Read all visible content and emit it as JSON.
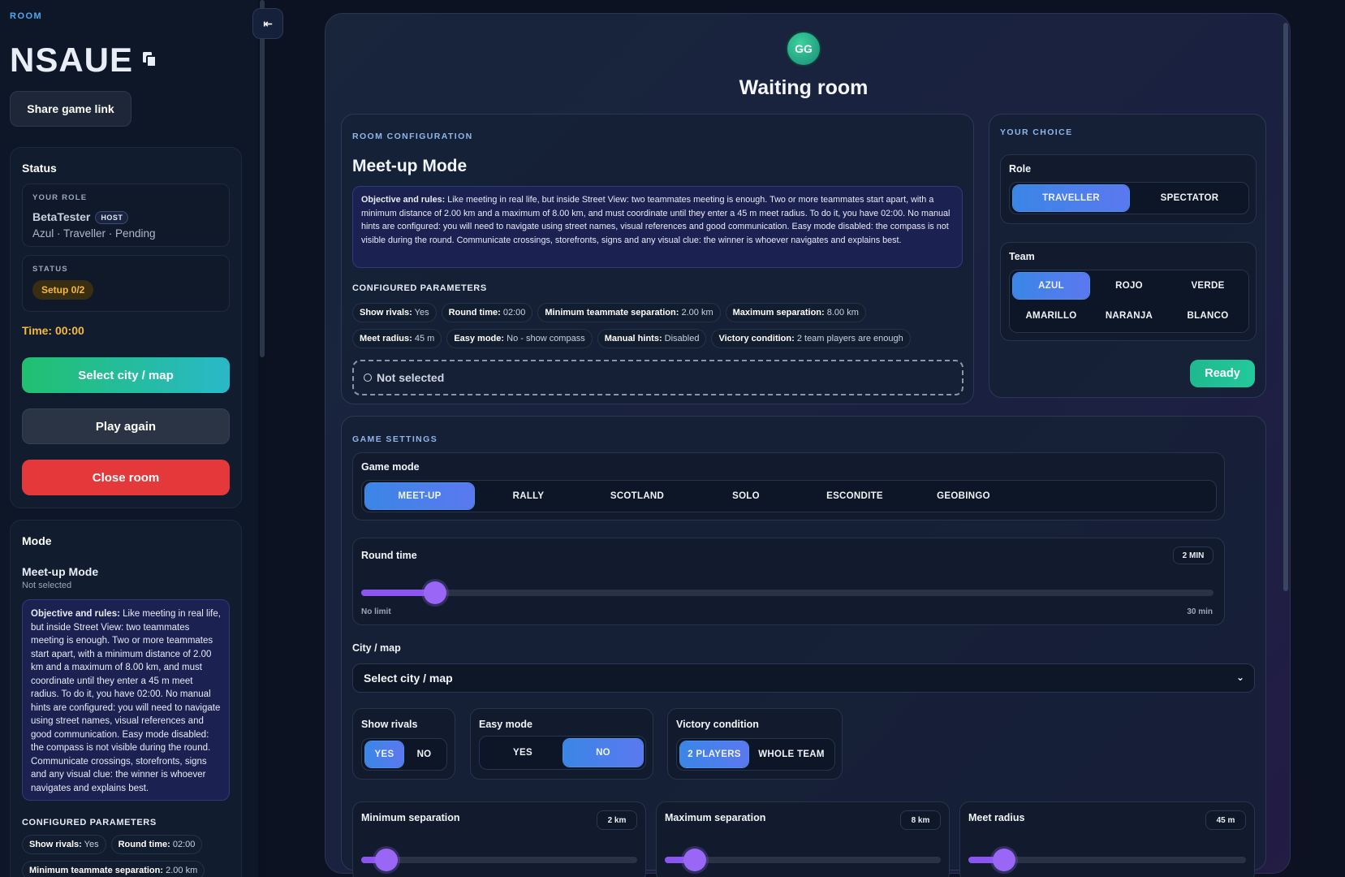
{
  "sidebar": {
    "room_label": "ROOM",
    "room_code": "NSAUE",
    "share_label": "Share game link",
    "status": {
      "heading": "Status",
      "your_role_label": "YOUR ROLE",
      "player_name": "BetaTester",
      "host_badge": "HOST",
      "role_detail": "Azul · Traveller · Pending",
      "status_label": "STATUS",
      "setup_badge": "Setup 0/2",
      "time": "Time: 00:00",
      "select_city_btn": "Select city / map",
      "play_again_btn": "Play again",
      "close_room_btn": "Close room"
    },
    "mode": {
      "heading": "Mode",
      "mode_name": "Meet-up Mode",
      "mode_sub": "Not selected",
      "objective_bold": "Objective and rules:",
      "objective_text": " Like meeting in real life, but inside Street View: two teammates meeting is enough. Two or more teammates start apart, with a minimum distance of 2.00 km and a maximum of 8.00 km, and must coordinate until they enter a 45 m meet radius. To do it, you have 02:00. No manual hints are configured: you will need to navigate using street names, visual references and good communication. Easy mode disabled: the compass is not visible during the round. Communicate crossings, storefronts, signs and any visual clue: the winner is whoever navigates and explains best.",
      "configured_label": "CONFIGURED PARAMETERS",
      "chips": [
        {
          "k": "Show rivals:",
          "v": " Yes"
        },
        {
          "k": "Round time:",
          "v": " 02:00"
        },
        {
          "k": "Minimum teammate separation:",
          "v": " 2.00 km"
        }
      ]
    }
  },
  "main": {
    "logo_text": "GG",
    "title": "Waiting room",
    "room_config": {
      "label": "ROOM CONFIGURATION",
      "mode_title": "Meet-up Mode",
      "objective_bold": "Objective and rules:",
      "objective_text": " Like meeting in real life, but inside Street View: two teammates meeting is enough. Two or more teammates start apart, with a minimum distance of 2.00 km and a maximum of 8.00 km, and must coordinate until they enter a 45 m meet radius. To do it, you have 02:00. No manual hints are configured: you will need to navigate using street names, visual references and good communication. Easy mode disabled: the compass is not visible during the round. Communicate crossings, storefronts, signs and any visual clue: the winner is whoever navigates and explains best.",
      "params_label": "CONFIGURED PARAMETERS",
      "chips": [
        {
          "k": "Show rivals:",
          "v": " Yes"
        },
        {
          "k": "Round time:",
          "v": " 02:00"
        },
        {
          "k": "Minimum teammate separation:",
          "v": " 2.00 km"
        },
        {
          "k": "Maximum separation:",
          "v": " 8.00 km"
        },
        {
          "k": "Meet radius:",
          "v": " 45 m"
        },
        {
          "k": "Easy mode:",
          "v": " No - show compass"
        },
        {
          "k": "Manual hints:",
          "v": " Disabled"
        },
        {
          "k": "Victory condition:",
          "v": " 2 team players are enough"
        }
      ],
      "not_selected": "Not selected"
    },
    "your_choice": {
      "label": "YOUR CHOICE",
      "role_heading": "Role",
      "roles": [
        "TRAVELLER",
        "SPECTATOR"
      ],
      "role_selected": "TRAVELLER",
      "team_heading": "Team",
      "teams": [
        "AZUL",
        "ROJO",
        "VERDE",
        "AMARILLO",
        "NARANJA",
        "BLANCO"
      ],
      "team_selected": "AZUL",
      "ready_btn": "Ready"
    },
    "game_settings": {
      "label": "GAME SETTINGS",
      "game_mode_heading": "Game mode",
      "modes": [
        "MEET-UP",
        "RALLY",
        "SCOTLAND",
        "SOLO",
        "ESCONDITE",
        "GEOBINGO"
      ],
      "mode_selected": "MEET-UP",
      "round_time": {
        "heading": "Round time",
        "value_badge": "2 MIN",
        "min_label": "No limit",
        "max_label": "30 min",
        "fraction": 0.087
      },
      "city_heading": "City / map",
      "city_select_value": "Select city / map",
      "show_rivals": {
        "heading": "Show rivals",
        "options": [
          "YES",
          "NO"
        ],
        "selected": "YES"
      },
      "easy_mode": {
        "heading": "Easy mode",
        "options": [
          "YES",
          "NO"
        ],
        "selected": "NO"
      },
      "victory": {
        "heading": "Victory condition",
        "options": [
          "2 PLAYERS",
          "WHOLE TEAM"
        ],
        "selected": "2 PLAYERS"
      },
      "min_sep": {
        "heading": "Minimum separation",
        "value_badge": "2 km",
        "fraction": 0.09
      },
      "max_sep": {
        "heading": "Maximum separation",
        "value_badge": "8 km",
        "fraction": 0.11
      },
      "meet_radius": {
        "heading": "Meet radius",
        "value_badge": "45 m",
        "fraction": 0.13
      }
    }
  },
  "colors": {
    "accent_blue": "#3a86e6",
    "slider_purple": "#9966f5",
    "success": "#23c99b",
    "danger": "#e5383b",
    "warning": "#f5b93b"
  }
}
